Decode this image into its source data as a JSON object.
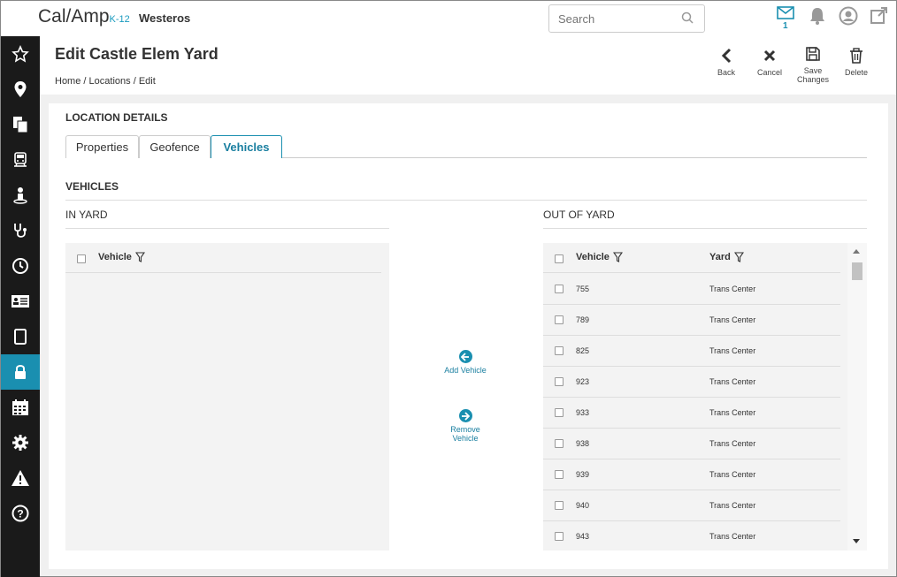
{
  "app": {
    "logo_main": "Cal/Amp",
    "logo_sub": "K-12",
    "org_name": "Westeros"
  },
  "search": {
    "placeholder": "Search"
  },
  "notifications": {
    "mail_count": "1"
  },
  "header": {
    "title": "Edit Castle Elem Yard",
    "breadcrumb": [
      "Home",
      "Locations",
      "Edit"
    ],
    "actions": [
      {
        "name": "back",
        "label": "Back"
      },
      {
        "name": "cancel",
        "label": "Cancel"
      },
      {
        "name": "save-changes",
        "label": "Save Changes"
      },
      {
        "name": "delete",
        "label": "Delete"
      }
    ]
  },
  "location_details": {
    "title": "LOCATION DETAILS",
    "tabs": [
      "Properties",
      "Geofence",
      "Vehicles"
    ],
    "active_tab": "Vehicles"
  },
  "vehicles_section": {
    "title": "VEHICLES",
    "in_yard": {
      "title": "IN YARD",
      "columns": [
        "Vehicle"
      ],
      "rows": []
    },
    "out_of_yard": {
      "title": "OUT OF YARD",
      "columns": [
        "Vehicle",
        "Yard"
      ],
      "rows": [
        {
          "vehicle": "755",
          "yard": "Trans Center"
        },
        {
          "vehicle": "789",
          "yard": "Trans Center"
        },
        {
          "vehicle": "825",
          "yard": "Trans Center"
        },
        {
          "vehicle": "923",
          "yard": "Trans Center"
        },
        {
          "vehicle": "933",
          "yard": "Trans Center"
        },
        {
          "vehicle": "938",
          "yard": "Trans Center"
        },
        {
          "vehicle": "939",
          "yard": "Trans Center"
        },
        {
          "vehicle": "940",
          "yard": "Trans Center"
        },
        {
          "vehicle": "943",
          "yard": "Trans Center"
        }
      ]
    },
    "add_label": "Add Vehicle",
    "remove_label": "Remove Vehicle"
  },
  "sidebar_icons": [
    "star-icon",
    "location-pin-icon",
    "documents-icon",
    "bus-icon",
    "driver-icon",
    "stethoscope-icon",
    "clock-icon",
    "id-card-icon",
    "tablet-icon",
    "lock-icon",
    "calendar-icon",
    "gear-icon",
    "warning-icon",
    "help-icon"
  ],
  "colors": {
    "accent": "#1a8fb0",
    "sidebar": "#1a1a1a"
  }
}
